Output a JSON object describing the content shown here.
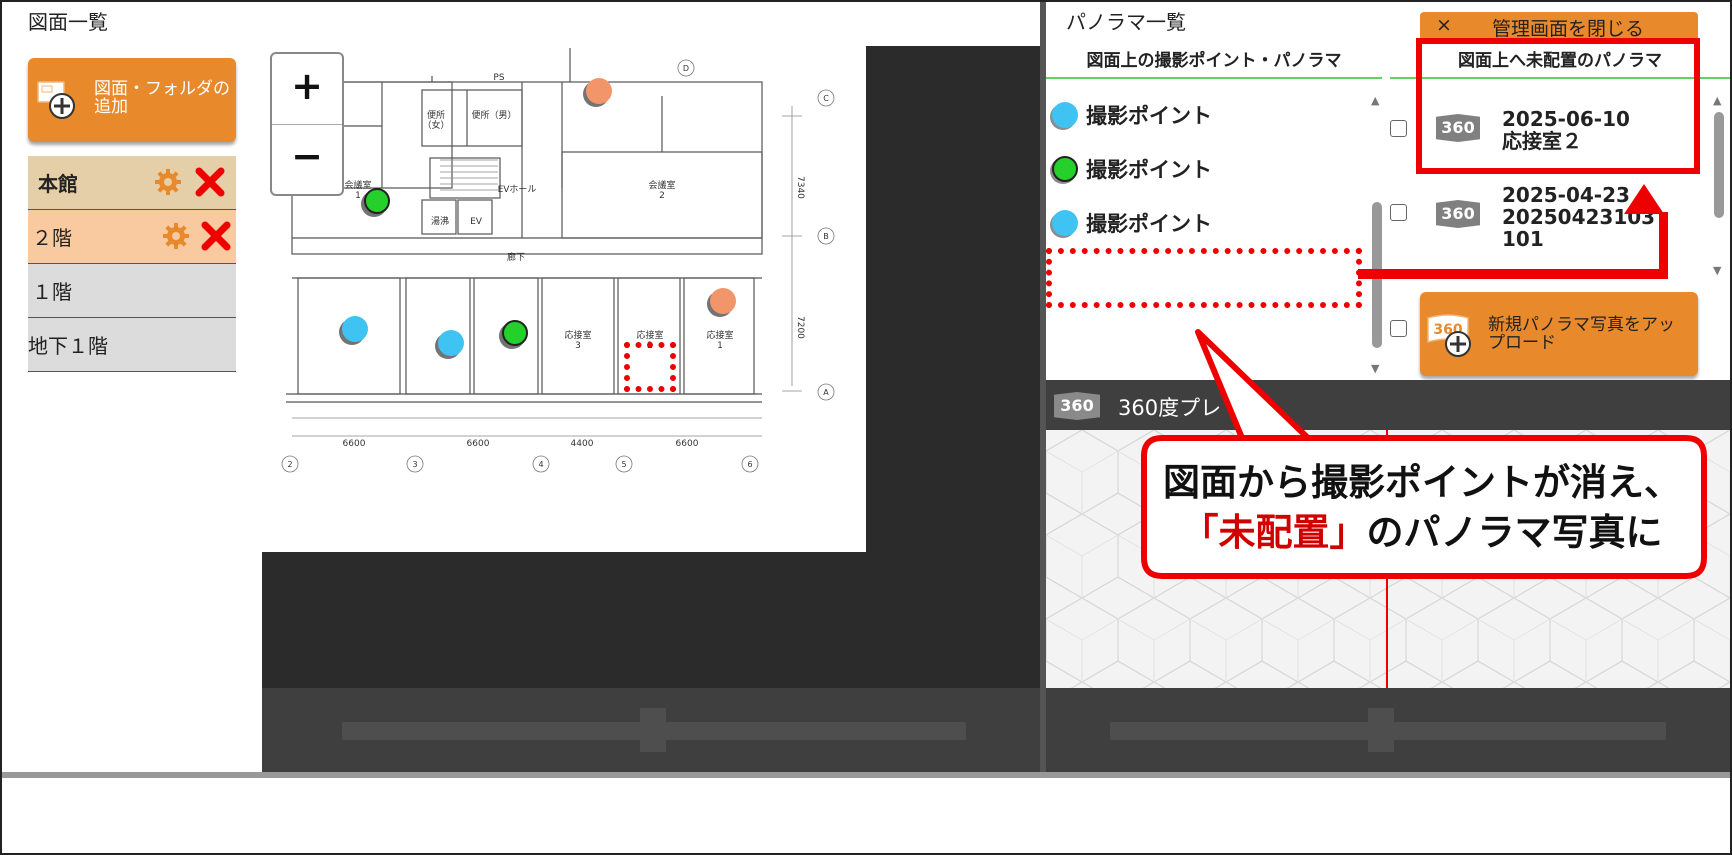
{
  "drawings_panel": {
    "title": "図面一覧",
    "add_button_label": "図面・フォルダの追加",
    "tree": [
      {
        "label": "本館",
        "kind": "building"
      },
      {
        "label": "２階",
        "kind": "floor-selected"
      },
      {
        "label": "１階",
        "kind": "floor"
      },
      {
        "label": "地下１階",
        "kind": "floor"
      }
    ]
  },
  "map": {
    "zoom_in": "+",
    "zoom_out": "−",
    "room_labels": {
      "meeting1": "会議室\n1",
      "meeting2": "会議室\n2",
      "toilet_f": "便所\n（女）",
      "toilet_m": "便所（男）",
      "ev_hall": "EVホール",
      "kitchen": "湯沸",
      "ev": "EV",
      "corridor": "廊下",
      "reception3": "応接室\n3",
      "reception2": "応接室\n2",
      "reception1": "応接室\n1",
      "ps": "PS"
    },
    "dimensions": [
      "6600",
      "6600",
      "4400",
      "6600"
    ],
    "vertical_dims": [
      "7340",
      "7200"
    ],
    "grid_numbers": [
      "②",
      "③",
      "④",
      "⑤",
      "⑥"
    ],
    "grid_letters": [
      "Ⓓ",
      "Ⓒ",
      "Ⓑ",
      "Ⓐ"
    ]
  },
  "panorama_panel": {
    "title": "パノラマ一覧",
    "close_button": {
      "x": "×",
      "label": "管理画面を閉じる"
    },
    "placed_header": "図面上の撮影ポイント・パノラマ",
    "unplaced_header": "図面上へ未配置のパノラマ",
    "placed_items": [
      {
        "label": "撮影ポイント",
        "color": "#3fc3f3"
      },
      {
        "label": "撮影ポイント",
        "color": "#23d12a"
      },
      {
        "label": "撮影ポイント",
        "color": "#3fc3f3"
      }
    ],
    "unplaced_items": [
      {
        "badge": "360",
        "line1": "2025-06-10",
        "line2": "応接室２",
        "line3": ""
      },
      {
        "badge": "360",
        "line1": "2025-04-23",
        "line2": "20250423103",
        "line3": "101"
      }
    ],
    "upload_button": {
      "badge": "360",
      "label": "新規パノラマ写真をアップロード"
    }
  },
  "preview": {
    "badge": "360",
    "label": "360度プレ"
  },
  "callout": {
    "line1": "図面から撮影ポイントが消え、",
    "line2_highlight": "「未配置」",
    "line2_rest": "のパノラマ写真に"
  },
  "colors": {
    "accent_orange": "#e8892b",
    "annotation_red": "#e00000",
    "header_underline": "#5fd35f"
  }
}
